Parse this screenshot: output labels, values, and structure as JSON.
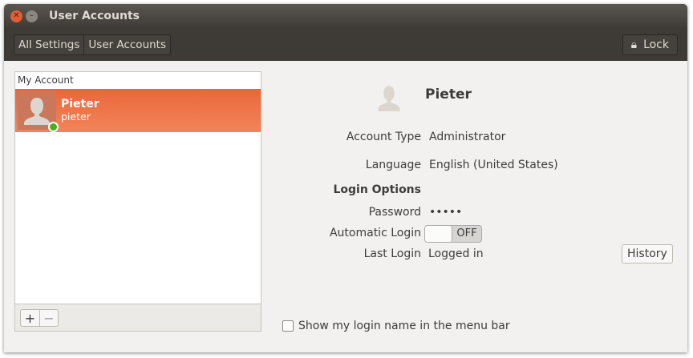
{
  "window": {
    "title": "User Accounts"
  },
  "toolbar": {
    "breadcrumbs": [
      "All Settings",
      "User Accounts"
    ],
    "lock_label": "Lock"
  },
  "accounts": {
    "header": "My Account",
    "users": [
      {
        "name": "Pieter",
        "username": "pieter"
      }
    ]
  },
  "details": {
    "name": "Pieter",
    "account_type_label": "Account Type",
    "account_type": "Administrator",
    "language_label": "Language",
    "language": "English (United States)",
    "login_options": "Login Options",
    "password_label": "Password",
    "password": "•••••",
    "auto_login_label": "Automatic Login",
    "auto_login": "OFF",
    "last_login_label": "Last Login",
    "last_login": "Logged in",
    "history_label": "History",
    "show_login_name": "Show my login name in the menu bar"
  }
}
